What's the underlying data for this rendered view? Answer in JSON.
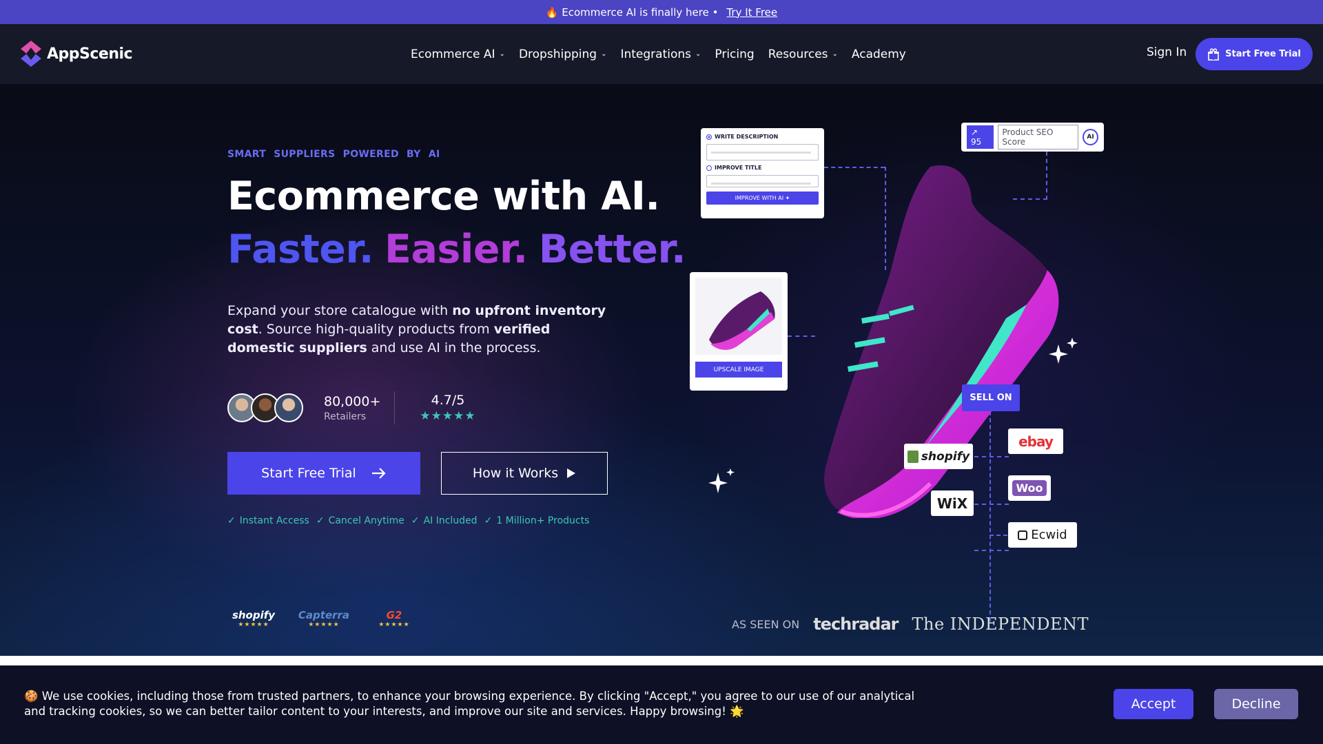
{
  "announcement": {
    "text": "🔥 Ecommerce AI is finally here •",
    "link": "Try It Free"
  },
  "nav": {
    "brand": "AppScenic",
    "items": [
      {
        "label": "Ecommerce AI",
        "dropdown": true
      },
      {
        "label": "Dropshipping",
        "dropdown": true
      },
      {
        "label": "Integrations",
        "dropdown": true
      },
      {
        "label": "Pricing",
        "dropdown": false
      },
      {
        "label": "Resources",
        "dropdown": true
      },
      {
        "label": "Academy",
        "dropdown": false
      }
    ],
    "sign_in": "Sign In",
    "cta": "Start Free Trial"
  },
  "hero": {
    "eyebrow": "SMART SUPPLIERS POWERED BY AI",
    "headline": "Ecommerce with AI.",
    "tagline": [
      "Faster.",
      "Easier.",
      "Better."
    ],
    "lead_parts": [
      {
        "text": "Expand your store catalogue with ",
        "bold": false
      },
      {
        "text": "no upfront inventory cost",
        "bold": true
      },
      {
        "text": ". Source high-quality products from ",
        "bold": false
      },
      {
        "text": "verified domestic suppliers",
        "bold": true
      },
      {
        "text": " and use AI in the process.",
        "bold": false
      }
    ],
    "retailers_count": "80,000+",
    "retailers_label": "Retailers",
    "rating": "4.7/5",
    "rating_stars": "★★★★★",
    "primary_cta": "Start Free Trial",
    "secondary_cta": "How it Works",
    "checks": [
      "Instant Access",
      "Cancel Anytime",
      "AI Included",
      "1 Million+ Products"
    ]
  },
  "visual": {
    "write_description": "WRITE DESCRIPTION",
    "improve_title": "IMPROVE TITLE",
    "improve_btn": "IMPROVE WITH AI ✦",
    "seo_score": "95",
    "seo_label": "Product SEO Score",
    "seo_ai": "AI",
    "upscale_btn": "UPSCALE IMAGE",
    "sell_on": "SELL ON",
    "platforms": [
      "shopify",
      "ebay",
      "WiX",
      "Woo",
      "Ecwid"
    ]
  },
  "trust": {
    "badges": [
      {
        "name": "shopify",
        "stars": "★★★★★",
        "color": "#ffffff"
      },
      {
        "name": "Capterra",
        "stars": "★★★★★",
        "color": "#5f8ac7"
      },
      {
        "name": "G2",
        "stars": "★★★★★",
        "color": "#ff492c"
      }
    ],
    "seen_on": "AS SEEN ON",
    "press": [
      "techradar",
      "The INDEPENDENT"
    ]
  },
  "cookie": {
    "text": "🍪 We use cookies, including those from trusted partners, to enhance your browsing experience. By clicking \"Accept,\" you agree to our use of our analytical and tracking cookies, so we can better tailor content to your interests, and improve our site and services. Happy browsing! 🌟",
    "accept": "Accept",
    "decline": "Decline"
  },
  "colors": {
    "accent": "#4b44e8",
    "announce_bg": "#4b44c3",
    "teal": "#3ec7b3",
    "magenta": "#b23dd8"
  }
}
